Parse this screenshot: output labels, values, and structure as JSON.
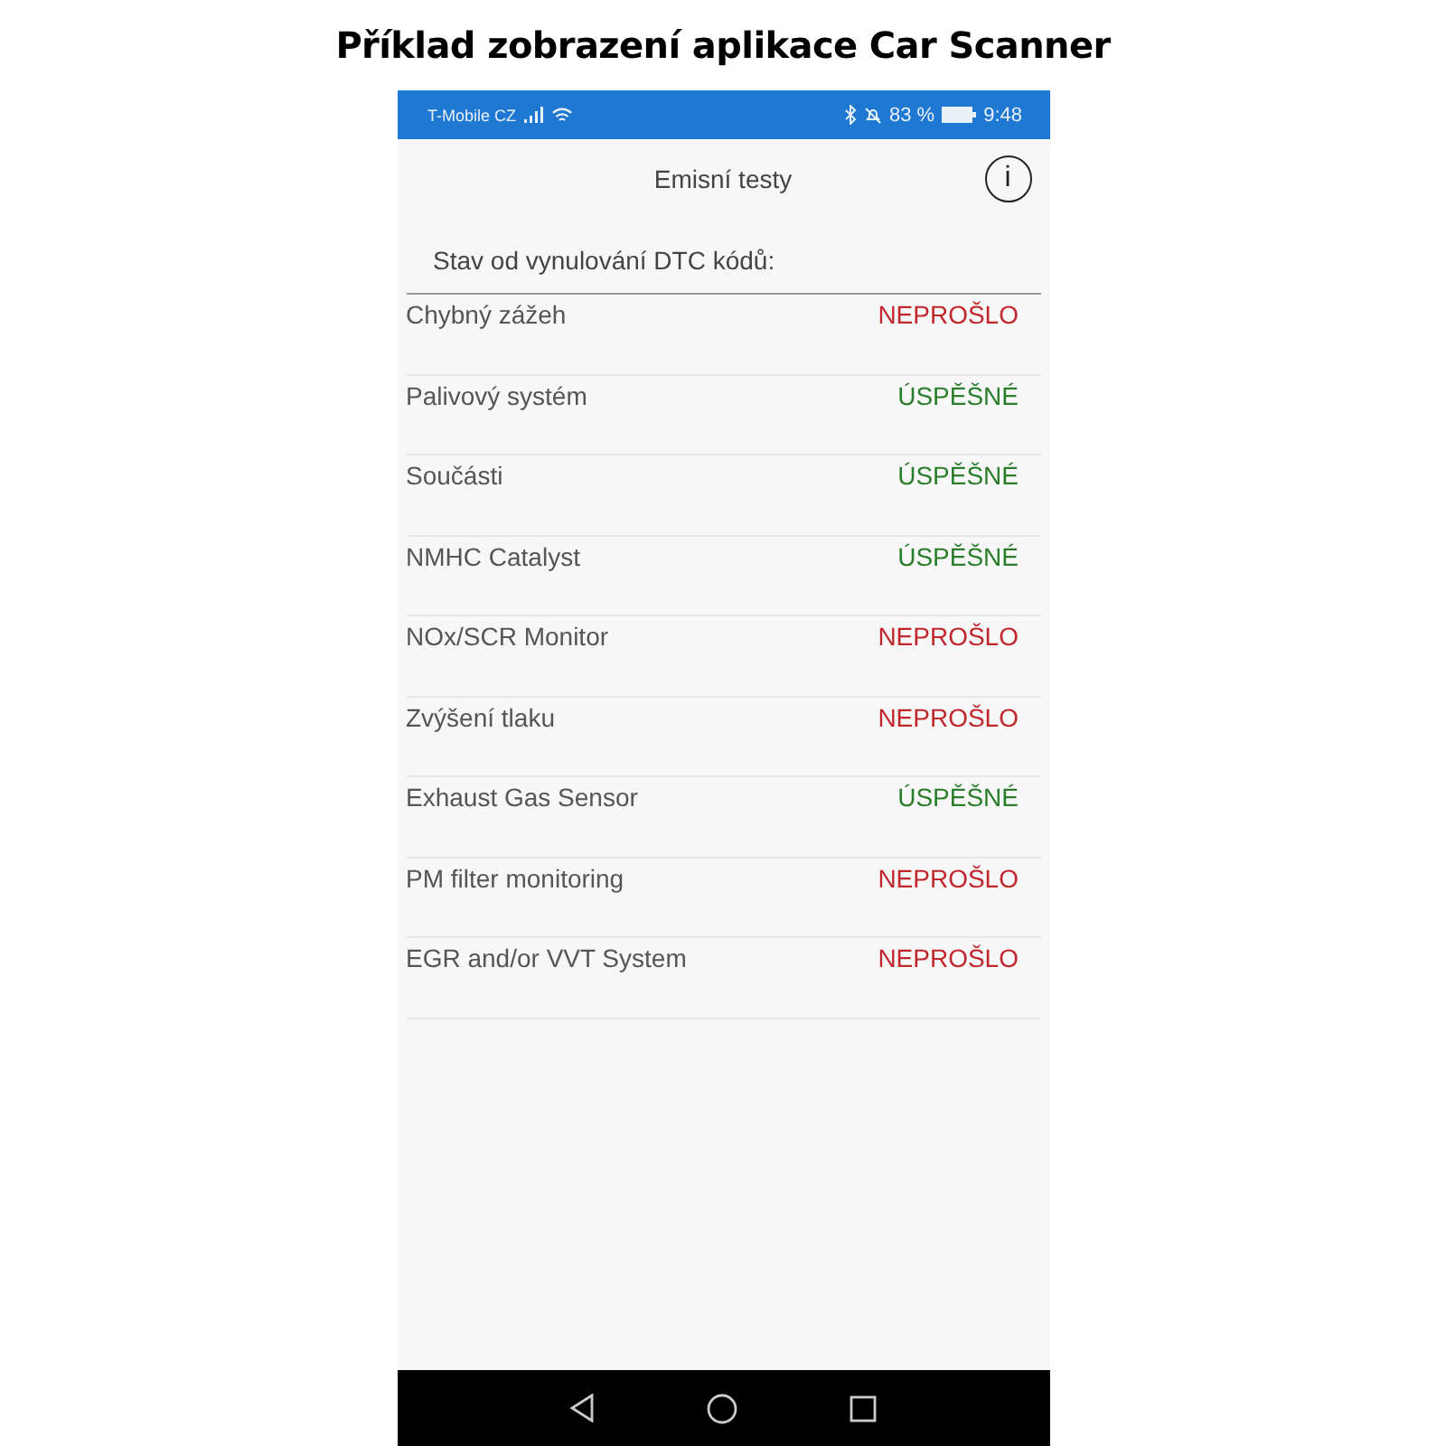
{
  "caption": "Příklad zobrazení aplikace Car Scanner",
  "status_bar": {
    "carrier": "T-Mobile CZ",
    "battery": "83 %",
    "time": "9:48"
  },
  "header": {
    "title": "Emisní testy",
    "info_icon": "i"
  },
  "subtitle": "Stav od vynulování DTC kódů:",
  "tests": [
    {
      "name": "Chybný zážeh",
      "result": "NEPROŠLO",
      "kind": "fail"
    },
    {
      "name": "Palivový systém",
      "result": "ÚSPĚŠNÉ",
      "kind": "pass"
    },
    {
      "name": "Součásti",
      "result": "ÚSPĚŠNÉ",
      "kind": "pass"
    },
    {
      "name": "NMHC Catalyst",
      "result": "ÚSPĚŠNÉ",
      "kind": "pass"
    },
    {
      "name": "NOx/SCR Monitor",
      "result": "NEPROŠLO",
      "kind": "fail"
    },
    {
      "name": "Zvýšení tlaku",
      "result": "NEPROŠLO",
      "kind": "fail"
    },
    {
      "name": "Exhaust Gas Sensor",
      "result": "ÚSPĚŠNÉ",
      "kind": "pass"
    },
    {
      "name": "PM filter monitoring",
      "result": "NEPROŠLO",
      "kind": "fail"
    },
    {
      "name": "EGR and/or VVT System",
      "result": "NEPROŠLO",
      "kind": "fail"
    }
  ]
}
